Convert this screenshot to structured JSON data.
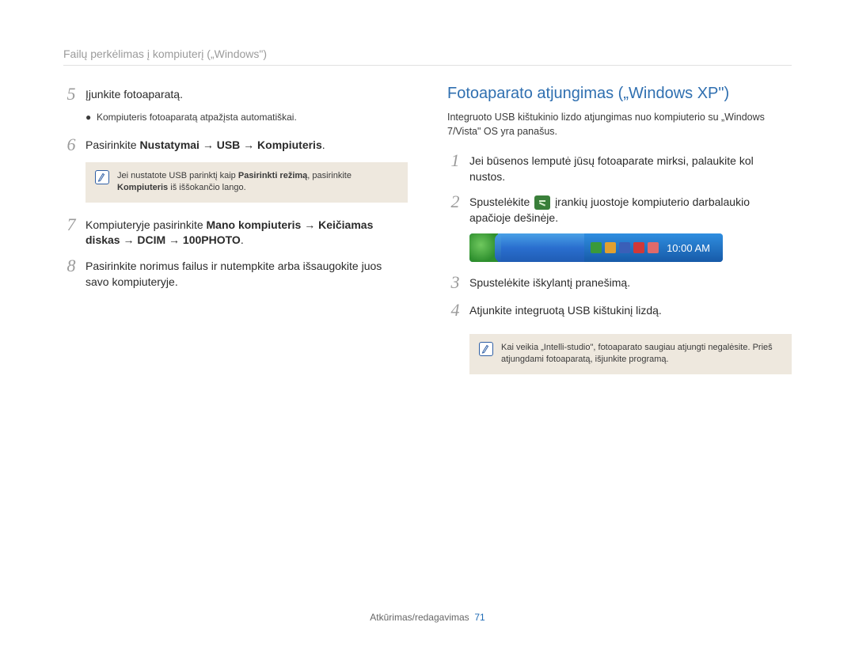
{
  "header": {
    "title": "Failų perkėlimas į kompiuterį („Windows\")"
  },
  "left": {
    "step5": {
      "num": "5",
      "text": "Įjunkite fotoaparatą."
    },
    "step5_sub": "Kompiuteris fotoaparatą atpažįsta automatiškai.",
    "step6": {
      "num": "6",
      "prefix": "Pasirinkite ",
      "bold": "Nustatymai → USB  → Kompiuteris",
      "suffix": "."
    },
    "note6_a": "Jei nustatote USB parinktį kaip ",
    "note6_bold1": "Pasirinkti režimą",
    "note6_b": ", pasirinkite ",
    "note6_bold2": "Kompiuteris",
    "note6_c": " iš iššokančio lango.",
    "step7": {
      "num": "7",
      "prefix": "Kompiuteryje pasirinkite ",
      "bold": "Mano kompiuteris → Keičiamas diskas → DCIM → 100PHOTO",
      "suffix": "."
    },
    "step8": {
      "num": "8",
      "text": "Pasirinkite norimus failus ir nutempkite arba išsaugokite juos savo kompiuteryje."
    }
  },
  "right": {
    "title": "Fotoaparato atjungimas („Windows XP\")",
    "intro": "Integruoto USB kištukinio lizdo atjungimas nuo kompiuterio su „Windows 7/Vista\" OS yra panašus.",
    "step1": {
      "num": "1",
      "text": "Jei būsenos lemputė jūsų fotoaparate mirksi, palaukite kol nustos."
    },
    "step2": {
      "num": "2",
      "text_a": "Spustelėkite ",
      "text_b": " įrankių juostoje kompiuterio darbalaukio apačioje dešinėje."
    },
    "taskbar_time": "10:00 AM",
    "step3": {
      "num": "3",
      "text": "Spustelėkite iškylantį pranešimą."
    },
    "step4": {
      "num": "4",
      "text": "Atjunkite integruotą USB kištukinį lizdą."
    },
    "note_a": "Kai veikia „Intelli-studio\", fotoaparato saugiau atjungti negalėsite. Prieš atjungdami fotoaparatą, išjunkite programą."
  },
  "footer": {
    "label": "Atkūrimas/redagavimas",
    "page": "71"
  }
}
